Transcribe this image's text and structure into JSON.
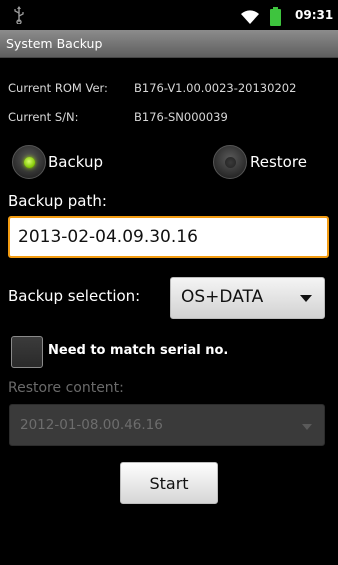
{
  "status_bar": {
    "time": "09:31",
    "icons": [
      "usb-icon",
      "wifi-icon",
      "battery-icon"
    ],
    "battery_color": "#3ec43e"
  },
  "app": {
    "title": "System Backup"
  },
  "info": {
    "rom_label": "Current ROM Ver:",
    "rom_value": "B176-V1.00.0023-20130202",
    "sn_label": "Current S/N:",
    "sn_value": "B176-SN000039"
  },
  "mode": {
    "backup_label": "Backup",
    "restore_label": "Restore",
    "selected": "Backup"
  },
  "backup_path": {
    "label": "Backup path:",
    "value": "2013-02-04.09.30.16"
  },
  "backup_selection": {
    "label": "Backup selection:",
    "value": "OS+DATA"
  },
  "match_serial": {
    "label": "Need to match serial no.",
    "checked": false
  },
  "restore_content": {
    "label": "Restore content:",
    "value": "2012-01-08.00.46.16"
  },
  "actions": {
    "start_label": "Start"
  },
  "colors": {
    "accent_focus": "#f39c12",
    "radio_on": "#7ec400",
    "title_bar": "#6f6f6f"
  }
}
